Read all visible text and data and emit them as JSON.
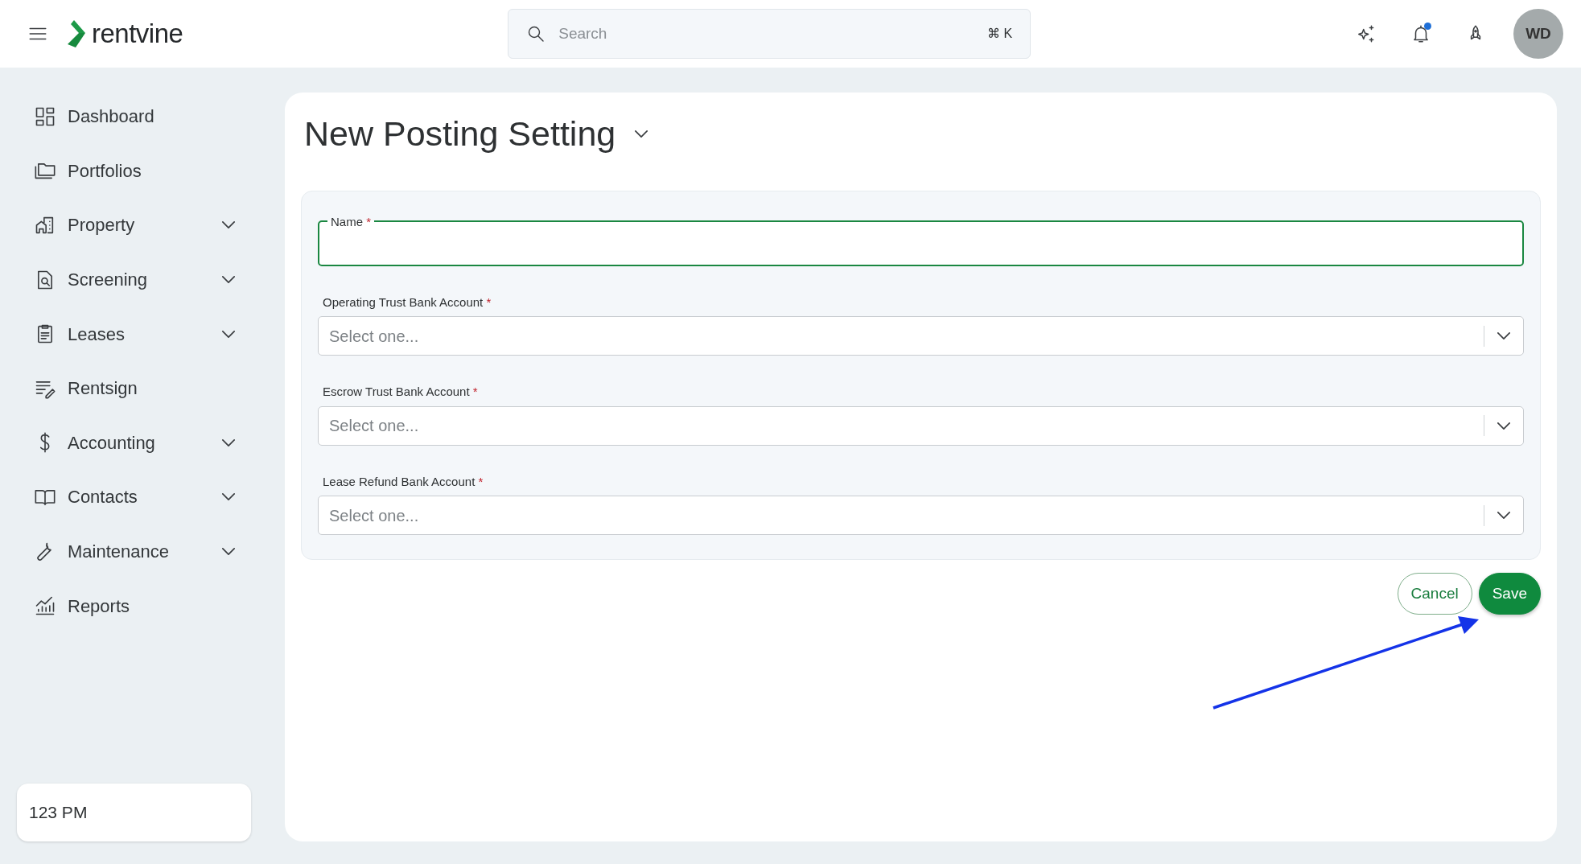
{
  "topbar": {
    "brand": "rentvine",
    "search": {
      "placeholder": "Search",
      "shortcut": "⌘ K"
    },
    "notifications": {
      "unread": true
    },
    "avatar": "WD"
  },
  "sidebar": {
    "items": [
      {
        "label": "Dashboard",
        "expandable": false
      },
      {
        "label": "Portfolios",
        "expandable": false
      },
      {
        "label": "Property",
        "expandable": true
      },
      {
        "label": "Screening",
        "expandable": true
      },
      {
        "label": "Leases",
        "expandable": true
      },
      {
        "label": "Rentsign",
        "expandable": false
      },
      {
        "label": "Accounting",
        "expandable": true
      },
      {
        "label": "Contacts",
        "expandable": true
      },
      {
        "label": "Maintenance",
        "expandable": true
      },
      {
        "label": "Reports",
        "expandable": false
      }
    ],
    "footer": "123 PM"
  },
  "page": {
    "title": "New Posting Setting",
    "fields": [
      {
        "kind": "text",
        "label": "Name",
        "required_mark": "*",
        "focused": true
      },
      {
        "kind": "select",
        "label": "Operating Trust Bank Account",
        "required_mark": "*",
        "focused": false,
        "placeholder": "Select one..."
      },
      {
        "kind": "select",
        "label": "Escrow Trust Bank Account",
        "required_mark": "*",
        "focused": false,
        "placeholder": "Select one..."
      },
      {
        "kind": "select",
        "label": "Lease Refund Bank Account",
        "required_mark": "*",
        "focused": false,
        "placeholder": "Select one..."
      }
    ],
    "buttons": [
      {
        "label": "Cancel",
        "kind": "outline"
      },
      {
        "label": "Save",
        "kind": "primary"
      }
    ]
  }
}
